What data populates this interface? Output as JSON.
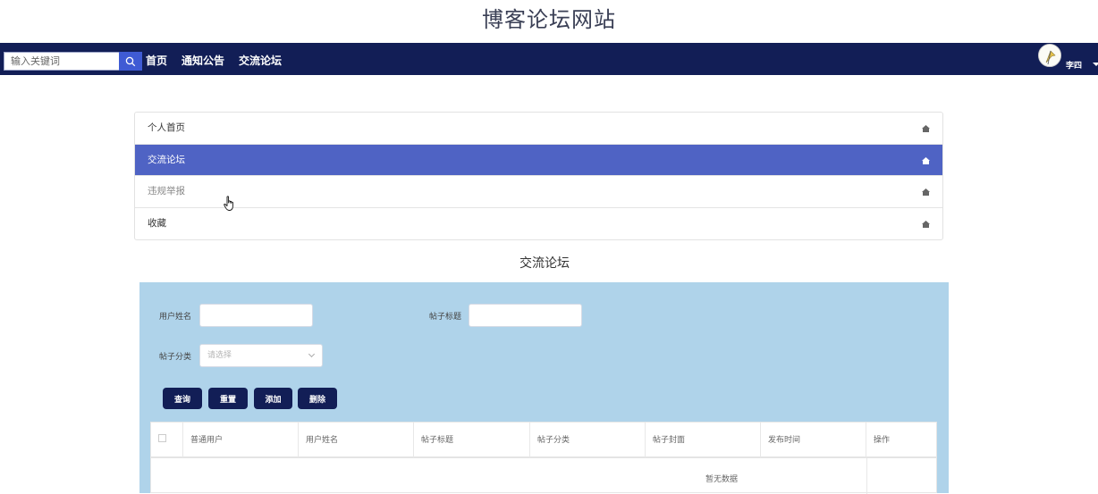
{
  "site": {
    "title": "博客论坛网站"
  },
  "navbar": {
    "search": {
      "placeholder": "输入关键词",
      "value": ""
    },
    "links": [
      {
        "label": "首页"
      },
      {
        "label": "通知公告"
      },
      {
        "label": "交流论坛"
      }
    ],
    "user": {
      "name": "李四"
    },
    "colors": {
      "bar": "#121e56",
      "search_button": "#3f5bd4"
    }
  },
  "menu": {
    "items": [
      {
        "label": "个人首页",
        "active": false
      },
      {
        "label": "交流论坛",
        "active": true
      },
      {
        "label": "违规举报",
        "active": false
      },
      {
        "label": "收藏",
        "active": false
      }
    ],
    "active_color": "#4f63c4"
  },
  "section": {
    "title": "交流论坛"
  },
  "filters": {
    "username_label": "用户姓名",
    "username_value": "",
    "post_title_label": "帖子标题",
    "post_title_value": "",
    "category_label": "帖子分类",
    "category_placeholder": "请选择"
  },
  "buttons": {
    "query": "查询",
    "reset": "重置",
    "add": "添加",
    "delete": "删除"
  },
  "table": {
    "columns": [
      "普通用户",
      "用户姓名",
      "帖子标题",
      "帖子分类",
      "帖子封面",
      "发布时间",
      "操作"
    ],
    "rows": [],
    "empty_text": "暂无数据"
  },
  "panel_color": "#afd3ea"
}
